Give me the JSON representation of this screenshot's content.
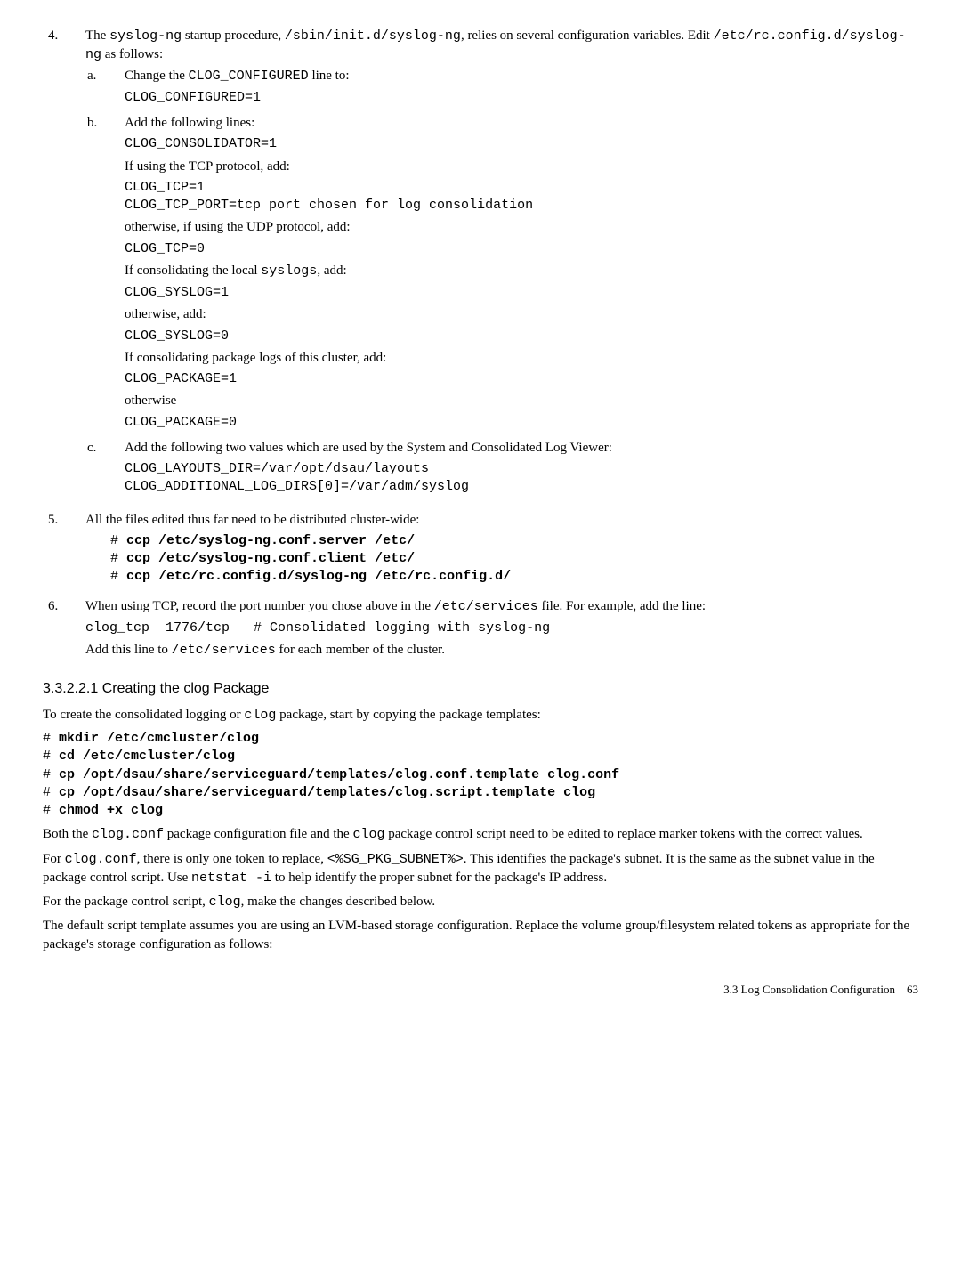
{
  "steps": {
    "s4": {
      "num": "4.",
      "intro_a": "The ",
      "intro_b": "syslog-ng",
      "intro_c": " startup procedure, ",
      "intro_d": "/sbin/init.d/syslog-ng",
      "intro_e": ", relies on several configuration variables. Edit ",
      "intro_f": "/etc/rc.config.d/syslog-ng",
      "intro_g": " as follows:",
      "a": {
        "num": "a.",
        "t1": "Change the ",
        "t2": "CLOG_CONFIGURED",
        "t3": " line to:",
        "c1": "CLOG_CONFIGURED=1"
      },
      "b": {
        "num": "b.",
        "t1": "Add the following lines:",
        "c1": "CLOG_CONSOLIDATOR=1",
        "p1": "If using the TCP protocol, add:",
        "c2": "CLOG_TCP=1\nCLOG_TCP_PORT=tcp port chosen for log consolidation",
        "p2": "otherwise, if using the UDP protocol, add:",
        "c3": "CLOG_TCP=0",
        "p3a": "If consolidating the local ",
        "p3b": "syslogs",
        "p3c": ", add:",
        "c4": "CLOG_SYSLOG=1",
        "p4": "otherwise, add:",
        "c5": "CLOG_SYSLOG=0",
        "p5": "If consolidating package logs of this cluster, add:",
        "c6": "CLOG_PACKAGE=1",
        "p6": "otherwise",
        "c7": "CLOG_PACKAGE=0"
      },
      "c": {
        "num": "c.",
        "t1": "Add the following two values which are used by the System and Consolidated Log Viewer:",
        "c1": "CLOG_LAYOUTS_DIR=/var/opt/dsau/layouts\nCLOG_ADDITIONAL_LOG_DIRS[0]=/var/adm/syslog"
      }
    },
    "s5": {
      "num": "5.",
      "t1": "All the files edited thus far need to be distributed cluster-wide:",
      "c1a": "# ",
      "c1b": "ccp /etc/syslog-ng.conf.server /etc/",
      "c2a": "# ",
      "c2b": "ccp /etc/syslog-ng.conf.client /etc/",
      "c3a": "# ",
      "c3b": "ccp /etc/rc.config.d/syslog-ng /etc/rc.config.d/"
    },
    "s6": {
      "num": "6.",
      "p1a": "When using TCP, record the port number you chose above in the ",
      "p1b": "/etc/services",
      "p1c": " file. For example, add the line:",
      "c1": "clog_tcp  1776/tcp   # Consolidated logging with syslog-ng",
      "p2a": "Add this line to ",
      "p2b": "/etc/services",
      "p2c": " for each member of the cluster."
    }
  },
  "section": {
    "title": "3.3.2.2.1 Creating the clog Package",
    "p1a": "To create the consolidated logging or ",
    "p1b": "clog",
    "p1c": " package, start by copying the package templates:",
    "cmds": {
      "l1a": "# ",
      "l1b": "mkdir /etc/cmcluster/clog",
      "l2a": "# ",
      "l2b": "cd /etc/cmcluster/clog",
      "l3a": "# ",
      "l3b": "cp /opt/dsau/share/serviceguard/templates/clog.conf.template clog.conf",
      "l4a": "# ",
      "l4b": "cp /opt/dsau/share/serviceguard/templates/clog.script.template clog",
      "l5a": "# ",
      "l5b": "chmod +x clog"
    },
    "p2a": "Both the ",
    "p2b": "clog.conf",
    "p2c": " package configuration file and the ",
    "p2d": "clog",
    "p2e": " package control script need to be edited to replace marker tokens with the correct values.",
    "p3a": "For ",
    "p3b": "clog.conf",
    "p3c": ", there is only one token to replace, ",
    "p3d": "<%SG_PKG_SUBNET%>",
    "p3e": ". This identifies the package's subnet. It is the same as the subnet value in the package control script. Use ",
    "p3f": "netstat -i",
    "p3g": " to help identify the proper subnet for the package's IP address.",
    "p4a": "For the package control script, ",
    "p4b": "clog",
    "p4c": ", make the changes described below.",
    "p5": "The default script template assumes you are using an LVM-based storage configuration. Replace the volume group/filesystem related tokens as appropriate for the package's storage configuration as follows:"
  },
  "footer": {
    "text": "3.3 Log Consolidation Configuration",
    "page": "63"
  }
}
